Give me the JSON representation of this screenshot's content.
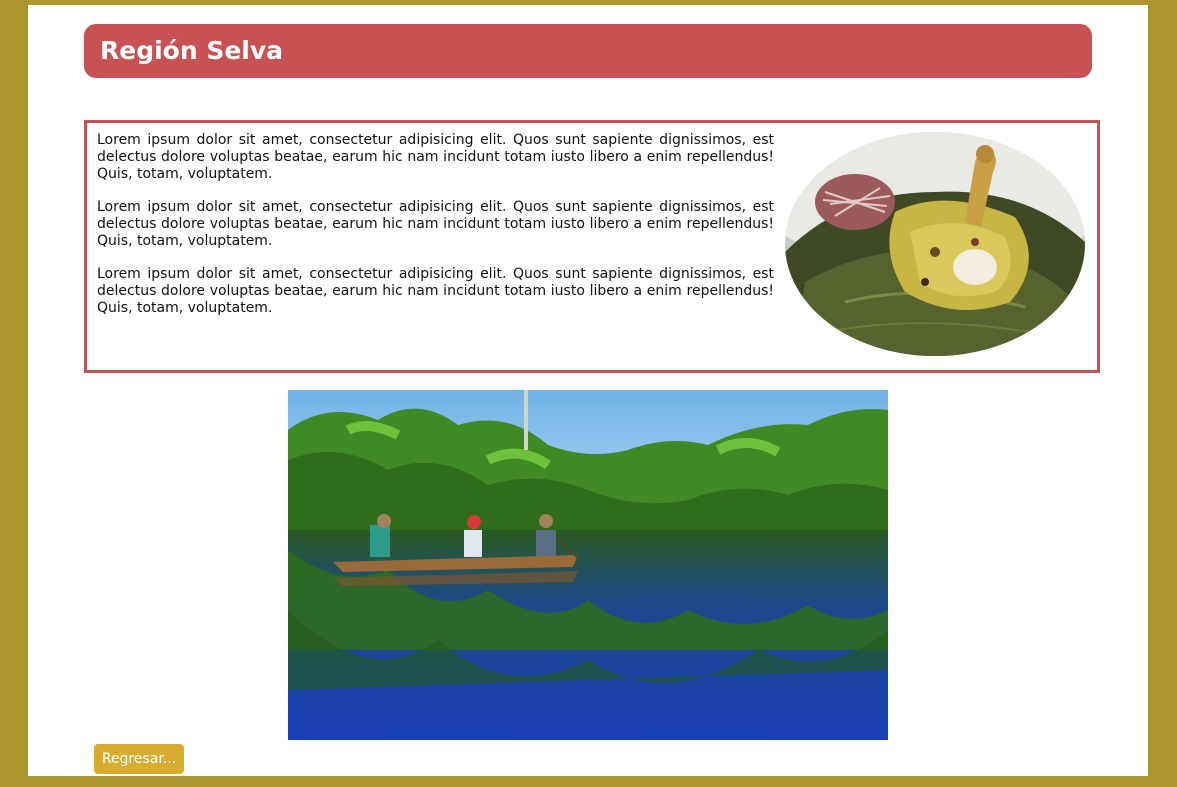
{
  "header": {
    "title": "Región Selva"
  },
  "content": {
    "paragraphs": [
      "Lorem ipsum dolor sit amet, consectetur adipisicing elit. Quos sunt sapiente dignissimos, est delectus dolore voluptas beatae, earum hic nam incidunt totam iusto libero a enim repellendus! Quis, totam, voluptatem.",
      "Lorem ipsum dolor sit amet, consectetur adipisicing elit. Quos sunt sapiente dignissimos, est delectus dolore voluptas beatae, earum hic nam incidunt totam iusto libero a enim repellendus! Quis, totam, voluptatem.",
      "Lorem ipsum dolor sit amet, consectetur adipisicing elit. Quos sunt sapiente dignissimos, est delectus dolore voluptas beatae, earum hic nam incidunt totam iusto libero a enim repellendus! Quis, totam, voluptatem."
    ]
  },
  "footer": {
    "back_label": "Regresar..."
  },
  "colors": {
    "page_border": "#ad952f",
    "title_bar": "#c85153",
    "box_border": "#c85153",
    "button": "#d8ac2e"
  }
}
